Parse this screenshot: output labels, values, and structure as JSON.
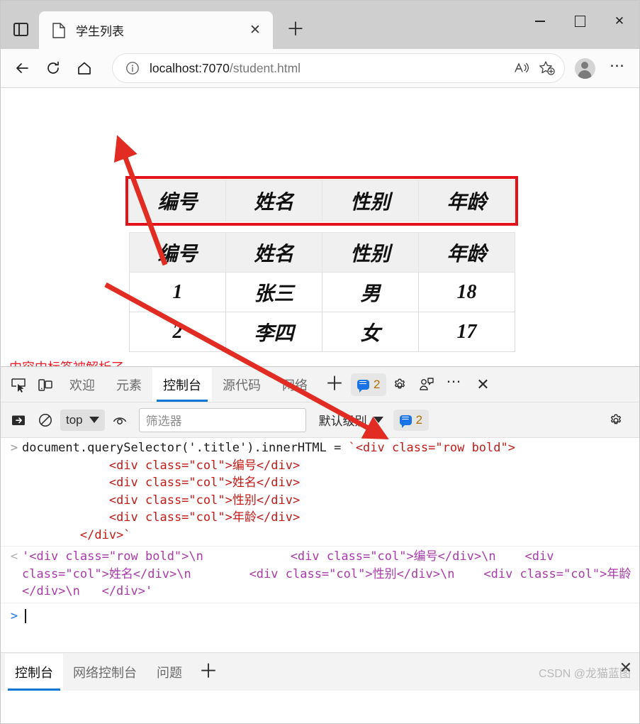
{
  "browser": {
    "tab": {
      "title": "学生列表",
      "favicon": "document-icon",
      "close_label": "✕"
    },
    "new_tab_label": "＋",
    "window": {
      "minimize": "−",
      "maximize": "□",
      "close": "✕"
    },
    "nav": {
      "back": "←",
      "reload": "⟳",
      "home": "⌂"
    },
    "address": {
      "host": "localhost:7070",
      "path": "/student.html",
      "full": "localhost:7070/student.html",
      "info_icon": "info-circle-icon",
      "read_aloud_icon": "read-aloud-icon",
      "favorite_icon": "add-favorite-star-icon"
    },
    "more_label": "⋯"
  },
  "page": {
    "title_row": {
      "cells": [
        "编号",
        "姓名",
        "性别",
        "年龄"
      ]
    },
    "table": {
      "headers": [
        "编号",
        "姓名",
        "性别",
        "年龄"
      ],
      "rows": [
        [
          "1",
          "张三",
          "男",
          "18"
        ],
        [
          "2",
          "李四",
          "女",
          "17"
        ]
      ]
    },
    "annotation": {
      "text": "内容中标签被解析了",
      "color": "#ee1c24"
    },
    "highlight_box_color": "#e4121b"
  },
  "devtools": {
    "toolbar": {
      "inspect_icon": "inspect-element-icon",
      "device_icon": "device-emulation-icon",
      "tabs": [
        {
          "label": "欢迎",
          "active": false
        },
        {
          "label": "元素",
          "active": false
        },
        {
          "label": "控制台",
          "active": true
        },
        {
          "label": "源代码",
          "active": false
        },
        {
          "label": "网络",
          "active": false
        }
      ],
      "add_tab_label": "＋",
      "issues_count": "2",
      "settings_icon": "gear-icon",
      "feedback_icon": "feedback-icon",
      "more_label": "⋯",
      "close_label": "✕"
    },
    "filterbar": {
      "sidebar_icon": "console-sidebar-icon",
      "clear_icon": "clear-console-icon",
      "context": "top",
      "eye_icon": "live-expression-icon",
      "filter_placeholder": "筛选器",
      "level": "默认级别",
      "level_count": "2",
      "settings_icon": "gear-icon"
    },
    "console": {
      "input_prompt": ">",
      "output_prompt": "<",
      "input": {
        "code_head": "document.querySelector('.title').innerHTML = ",
        "string_lines": [
          "`<div class=\"row bold\">",
          "            <div class=\"col\">编号</div>",
          "            <div class=\"col\">姓名</div>",
          "            <div class=\"col\">性别</div>",
          "            <div class=\"col\">年龄</div>",
          "        </div>`"
        ]
      },
      "output": "'<div class=\"row bold\">\\n            <div class=\"col\">编号</div>\\n    <div class=\"col\">姓名</div>\\n        <div class=\"col\">性别</div>\\n    <div class=\"col\">年龄</div>\\n   </div>'",
      "prompt_next": ">"
    },
    "drawer": {
      "tabs": [
        {
          "label": "控制台",
          "active": true
        },
        {
          "label": "网络控制台",
          "active": false
        },
        {
          "label": "问题",
          "active": false
        }
      ],
      "add_label": "＋",
      "close_label": "✕"
    }
  },
  "watermark": "CSDN @龙猫蓝图"
}
